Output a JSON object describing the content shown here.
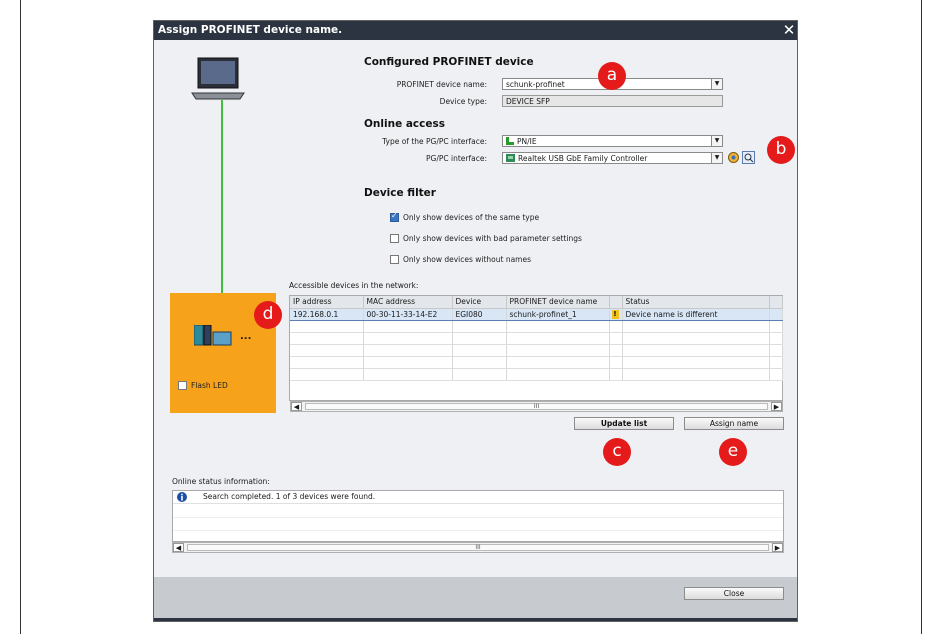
{
  "dialog": {
    "title": "Assign PROFINET device name.",
    "close_glyph": "✕"
  },
  "configured": {
    "heading": "Configured PROFINET device",
    "name_label": "PROFINET device name:",
    "name_value": "schunk-profinet",
    "type_label": "Device type:",
    "type_value": "DEVICE SFP"
  },
  "online": {
    "heading": "Online access",
    "iface_type_label": "Type of the PG/PC interface:",
    "iface_type_value": "PN/IE",
    "iface_label": "PG/PC interface:",
    "iface_value": "Realtek USB GbE Family Controller"
  },
  "filter": {
    "heading": "Device filter",
    "options": [
      {
        "label": "Only show devices of the same type",
        "checked": true
      },
      {
        "label": "Only show devices with bad parameter settings",
        "checked": false
      },
      {
        "label": "Only show devices without names",
        "checked": false
      }
    ]
  },
  "network": {
    "label": "Accessible devices in the network:",
    "columns": [
      "IP address",
      "MAC address",
      "Device",
      "PROFINET device name",
      "Status"
    ],
    "rows": [
      {
        "ip": "192.168.0.1",
        "mac": "00-30-11-33-14-E2",
        "device": "EGI080",
        "name": "schunk-profinet_1",
        "status": "Device name is different"
      }
    ],
    "scroll_thumb": "III"
  },
  "device_panel": {
    "flash_led_label": "Flash LED",
    "ellipsis": "..."
  },
  "buttons": {
    "update_list": "Update list",
    "assign_name": "Assign name",
    "close": "Close"
  },
  "status_info": {
    "label": "Online status information:",
    "message": "Search completed. 1 of 3 devices were found.",
    "scroll_thumb": "III"
  },
  "badges": {
    "a": "a",
    "b": "b",
    "c": "c",
    "d": "d",
    "e": "e"
  },
  "colors": {
    "accent_orange": "#f7a21b",
    "cable_green": "#3cbf3c",
    "badge_red": "#e51b1b",
    "titlebar": "#2b3440"
  }
}
